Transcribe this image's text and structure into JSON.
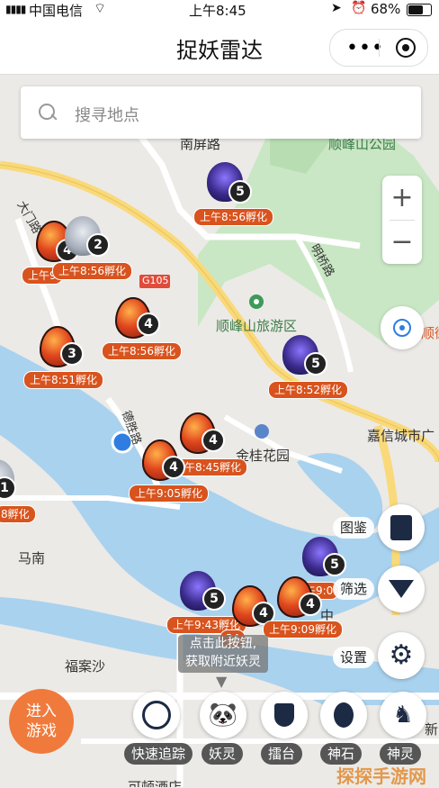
{
  "status_bar": {
    "carrier": "中国电信",
    "time": "上午8:45",
    "battery": "68%"
  },
  "nav": {
    "title": "捉妖雷达"
  },
  "search": {
    "placeholder": "搜寻地点"
  },
  "zoom": {
    "in": "+",
    "out": "−"
  },
  "map_labels": {
    "nanping_road": "南屏路",
    "shunfeng_park": "顺峰山公园",
    "damen_road": "大门路",
    "g105": "G105",
    "mingchuan_road": "明桥路",
    "scenic_area": "顺峰山旅游区",
    "shun": "顺街",
    "desheng_road": "德胜路",
    "jingui_garden": "金桂花园",
    "jiaxin_plaza": "嘉信城市广",
    "manan": "马南",
    "fuansha": "福案沙",
    "hotel": "可顿酒店",
    "xin": "新",
    "zhongshan": "中"
  },
  "markers": [
    {
      "count": "5",
      "time": "上午8:56孵化"
    },
    {
      "count": "4",
      "time": "上午9"
    },
    {
      "count": "2",
      "time": "上午8:56孵化"
    },
    {
      "count": "4",
      "time": "上午8:56孵化"
    },
    {
      "count": "3",
      "time": "上午8:51孵化"
    },
    {
      "count": "5",
      "time": "上午8:52孵化"
    },
    {
      "count": "4",
      "time": "上午8:45孵化"
    },
    {
      "count": "4",
      "time": "上午9:05孵化"
    },
    {
      "count": "1",
      "time": "8孵化"
    },
    {
      "count": "5",
      "time": "上午9:0"
    },
    {
      "count": "5",
      "time": "上午9:43孵化"
    },
    {
      "count": "4",
      "time": "34"
    },
    {
      "count": "4",
      "time": "上午9:09孵化"
    }
  ],
  "side_buttons": {
    "tujian": "图鉴",
    "filter": "筛选",
    "settings": "设置"
  },
  "bottom": {
    "enter_line1": "进入",
    "enter_line2": "游戏",
    "hint_line1": "点击此按钮,",
    "hint_line2": "获取附近妖灵",
    "track": "快速追踪",
    "yaoling": "妖灵",
    "leitai": "擂台",
    "shenshi": "神石",
    "shenling": "神灵"
  },
  "watermark": "探探手游网",
  "colors": {
    "accent": "#f07a3c",
    "water": "#a9d2ef",
    "park": "#c9e7c4",
    "road": "#f9d97a",
    "tag": "#d8531d"
  }
}
